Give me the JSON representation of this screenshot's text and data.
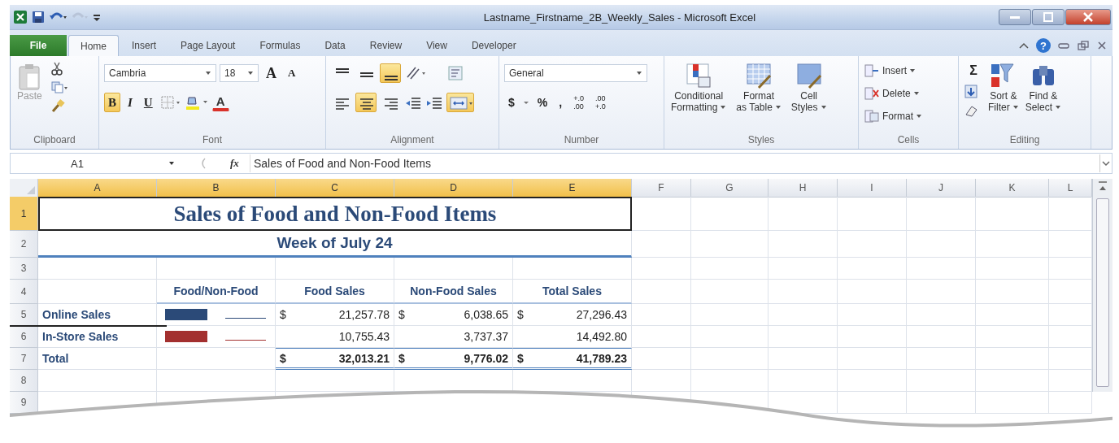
{
  "window": {
    "title": "Lastname_Firstname_2B_Weekly_Sales - Microsoft Excel"
  },
  "tabs": [
    {
      "label": "File",
      "kind": "file",
      "selected": false
    },
    {
      "label": "Home",
      "kind": "tab",
      "selected": true
    },
    {
      "label": "Insert",
      "kind": "tab",
      "selected": false
    },
    {
      "label": "Page Layout",
      "kind": "tab",
      "selected": false
    },
    {
      "label": "Formulas",
      "kind": "tab",
      "selected": false
    },
    {
      "label": "Data",
      "kind": "tab",
      "selected": false
    },
    {
      "label": "Review",
      "kind": "tab",
      "selected": false
    },
    {
      "label": "View",
      "kind": "tab",
      "selected": false
    },
    {
      "label": "Developer",
      "kind": "tab",
      "selected": false
    }
  ],
  "help_glyph": "?",
  "ribbon": {
    "clipboard": {
      "label": "Clipboard",
      "paste": "Paste"
    },
    "font": {
      "label": "Font",
      "name": "Cambria",
      "size": "18",
      "grow": "A",
      "shrink": "A",
      "font_color": "A",
      "styles": [
        {
          "glyph": "B",
          "kind": "bold",
          "selected": true
        },
        {
          "glyph": "I",
          "kind": "italic",
          "selected": false
        },
        {
          "glyph": "U",
          "kind": "underline",
          "selected": false
        }
      ]
    },
    "alignment": {
      "label": "Alignment",
      "vertical": [
        {
          "kind": "top",
          "selected": false
        },
        {
          "kind": "middle",
          "selected": false
        },
        {
          "kind": "bottom",
          "selected": true
        }
      ],
      "horizontal": [
        {
          "kind": "left",
          "selected": false
        },
        {
          "kind": "center",
          "selected": true
        },
        {
          "kind": "right",
          "selected": false
        }
      ],
      "merge_selected": true
    },
    "number": {
      "label": "Number",
      "format": "General",
      "currency": "$",
      "percent": "%",
      "comma": ",",
      "decimals": [
        {
          "top": "+.0",
          "bottom": ".00"
        },
        {
          "top": ".00",
          "bottom": "+.0"
        }
      ]
    },
    "styles": {
      "label": "Styles",
      "buttons": [
        {
          "line1": "Conditional",
          "line2": "Formatting",
          "kind": "conditional"
        },
        {
          "line1": "Format",
          "line2": "as Table",
          "kind": "table"
        },
        {
          "line1": "Cell",
          "line2": "Styles",
          "kind": "cell"
        }
      ]
    },
    "cells": {
      "label": "Cells",
      "buttons": [
        {
          "label": "Insert",
          "kind": "insert"
        },
        {
          "label": "Delete",
          "kind": "delete"
        },
        {
          "label": "Format",
          "kind": "format"
        }
      ]
    },
    "editing": {
      "label": "Editing",
      "sum": "Σ",
      "buttons": [
        {
          "line1": "Sort &",
          "line2": "Filter",
          "kind": "sort"
        },
        {
          "line1": "Find &",
          "line2": "Select",
          "kind": "find"
        }
      ]
    }
  },
  "formula_bar": {
    "name_box": "A1",
    "fx": "fx",
    "content": "Sales of Food and Non-Food Items"
  },
  "columns": [
    {
      "label": "A",
      "selected": true
    },
    {
      "label": "B",
      "selected": true
    },
    {
      "label": "C",
      "selected": true
    },
    {
      "label": "D",
      "selected": true
    },
    {
      "label": "E",
      "selected": true
    },
    {
      "label": "F",
      "selected": false
    },
    {
      "label": "G",
      "selected": false
    },
    {
      "label": "H",
      "selected": false
    },
    {
      "label": "I",
      "selected": false
    },
    {
      "label": "J",
      "selected": false
    },
    {
      "label": "K",
      "selected": false
    },
    {
      "label": "L",
      "selected": false
    }
  ],
  "rows": [
    {
      "number": "1",
      "kind": "title",
      "selected": true,
      "text": "Sales of Food and Non-Food Items"
    },
    {
      "number": "2",
      "kind": "subtitle",
      "selected": false,
      "text": "Week of July 24"
    },
    {
      "number": "3",
      "kind": "blank",
      "selected": false
    },
    {
      "number": "4",
      "kind": "header",
      "selected": false,
      "headers": [
        "Food/Non-Food",
        "Food Sales",
        "Non-Food Sales",
        "Total Sales"
      ]
    },
    {
      "number": "5",
      "kind": "data",
      "selected": false,
      "label": "Online Sales",
      "color": "#2b4a78",
      "values": [
        {
          "currency": "$",
          "amount": "21,257.78"
        },
        {
          "currency": "$",
          "amount": "6,038.65"
        },
        {
          "currency": "$",
          "amount": "27,296.43"
        }
      ]
    },
    {
      "number": "6",
      "kind": "data",
      "selected": false,
      "label": "In-Store Sales",
      "color": "#a3302f",
      "values": [
        {
          "amount": "10,755.43"
        },
        {
          "amount": "3,737.37"
        },
        {
          "amount": "14,492.80"
        }
      ]
    },
    {
      "number": "7",
      "kind": "total",
      "selected": false,
      "label": "Total",
      "values": [
        {
          "currency": "$",
          "amount": "32,013.21"
        },
        {
          "currency": "$",
          "amount": "9,776.02"
        },
        {
          "currency": "$",
          "amount": "41,789.23"
        }
      ]
    },
    {
      "number": "8",
      "kind": "blank",
      "selected": false
    },
    {
      "number": "9",
      "kind": "blank",
      "selected": false
    }
  ]
}
